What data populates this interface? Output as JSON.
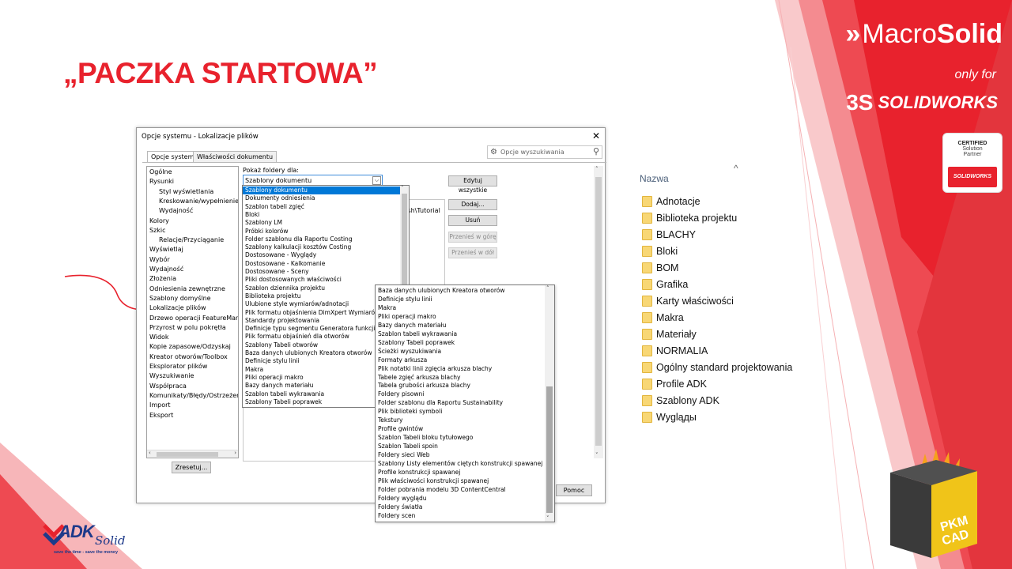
{
  "slide": {
    "title": "„PACZKA STARTOWA”",
    "brand": {
      "arrows": "»",
      "name_regular": "Macro",
      "name_bold": "Solid",
      "only_for": "only for",
      "solidworks_ds": "3S",
      "solidworks_text": "SOLIDWORKS"
    },
    "cert_badge": {
      "line1": "CERTIFIED",
      "line2": "Solution",
      "line3": "Partner",
      "strip": "SOLIDWORKS"
    },
    "adk_logo": {
      "big": "ADK",
      "script": "Solid",
      "tagline": "save the time - save the money"
    },
    "pkm_badge": "PKM CAD",
    "colors": {
      "accent_red": "#e8222d",
      "selection_blue": "#0078d7"
    }
  },
  "dialog": {
    "title": "Opcje systemu - Lokalizacje plików",
    "close_icon": "close-icon",
    "tabs": [
      "Opcje systemu",
      "Właściwości dokumentu"
    ],
    "search_placeholder": "Opcje wyszukiwania",
    "tree_items": [
      {
        "label": "Ogólne",
        "indent": 0
      },
      {
        "label": "Rysunki",
        "indent": 0
      },
      {
        "label": "Styl wyświetlania",
        "indent": 1
      },
      {
        "label": "Kreskowanie/wypełnienie o",
        "indent": 1
      },
      {
        "label": "Wydajność",
        "indent": 1
      },
      {
        "label": "Kolory",
        "indent": 0
      },
      {
        "label": "Szkic",
        "indent": 0
      },
      {
        "label": "Relacje/Przyciąganie",
        "indent": 1
      },
      {
        "label": "Wyświetlaj",
        "indent": 0
      },
      {
        "label": "Wybór",
        "indent": 0
      },
      {
        "label": "Wydajność",
        "indent": 0
      },
      {
        "label": "Złożenia",
        "indent": 0
      },
      {
        "label": "Odniesienia zewnętrzne",
        "indent": 0
      },
      {
        "label": "Szablony domyślne",
        "indent": 0
      },
      {
        "label": "Lokalizacje plików",
        "indent": 0
      },
      {
        "label": "Drzewo operacji FeatureManag",
        "indent": 0
      },
      {
        "label": "Przyrost w polu pokrętła",
        "indent": 0
      },
      {
        "label": "Widok",
        "indent": 0
      },
      {
        "label": "Kopie zapasowe/Odzyskaj",
        "indent": 0
      },
      {
        "label": "Kreator otworów/Toolbox",
        "indent": 0
      },
      {
        "label": "Eksplorator plików",
        "indent": 0
      },
      {
        "label": "Wyszukiwanie",
        "indent": 0
      },
      {
        "label": "Współpraca",
        "indent": 0
      },
      {
        "label": "Komunikaty/Błędy/Ostrzeżenia",
        "indent": 0
      },
      {
        "label": "Import",
        "indent": 0
      },
      {
        "label": "Eksport",
        "indent": 0
      }
    ],
    "reset_button": "Zresetuj...",
    "show_folders_label": "Pokaż foldery dla:",
    "combo_value": "Szablony dokumentu",
    "edit_all_button": "Edytuj wszystkie",
    "add_button": "Dodaj...",
    "delete_button": "Usuń",
    "move_up_button": "Przenieś w górę",
    "move_down_button": "Przenieś w dół",
    "path_fragment": "lish\\Tutorial",
    "help_button": "Pomoc"
  },
  "dropdown1": {
    "selected_index": 0,
    "items": [
      "Szablony dokumentu",
      "Dokumenty odniesienia",
      "Szablon tabeli zgięć",
      "Bloki",
      "Szablony LM",
      "Próbki kolorów",
      "Folder szablonu dla Raportu Costing",
      "Szablony kalkulacji kosztów Costing",
      "Dostosowane - Wyglądy",
      "Dostosowane - Kalkomanie",
      "Dostosowane - Sceny",
      "Pliki dostosowanych właściwości",
      "Szablon dziennika projektu",
      "Biblioteka projektu",
      "Ulubione style wymiarów/adnotacji",
      "Plik formatu objaśnienia DimXpert Wymiarów",
      "Standardy projektowania",
      "Definicje typu segmentu Generatora funkcji",
      "Plik formatu objaśnień dla otworów",
      "Szablony Tabeli otworów",
      "Baza danych ulubionych Kreatora otworów",
      "Definicje stylu linii",
      "Makra",
      "Pliki operacji makro",
      "Bazy danych materiału",
      "Szablon tabeli wykrawania",
      "Szablony Tabeli poprawek"
    ]
  },
  "dropdown2": {
    "items": [
      "Baza danych ulubionych Kreatora otworów",
      "Definicje stylu linii",
      "Makra",
      "Pliki operacji makro",
      "Bazy danych materiału",
      "Szablon tabeli wykrawania",
      "Szablony Tabeli poprawek",
      "Ścieżki wyszukiwania",
      "Formaty arkusza",
      "Plik notatki linii zgięcia arkusza blachy",
      "Tabele zgięć arkusza blachy",
      "Tabela grubości arkusza blachy",
      "Foldery pisowni",
      "Folder szablonu dla Raportu Sustainability",
      "Plik biblioteki symboli",
      "Tekstury",
      "Profile gwintów",
      "Szablon Tabeli bloku tytułowego",
      "Szablon Tabeli spoin",
      "Foldery sieci Web",
      "Szablony Listy elementów ciętych konstrukcji spawanej",
      "Profile konstrukcji spawanej",
      "Plik właściwości konstrukcji spawanej",
      "Folder pobrania modelu 3D ContentCentral",
      "Foldery wyglądu",
      "Foldery światła",
      "Foldery scen"
    ]
  },
  "folders": {
    "header": "Nazwa",
    "items": [
      "Adnotacje",
      "Biblioteka projektu",
      "BLACHY",
      "Bloki",
      "BOM",
      "Grafika",
      "Karty właściwości",
      "Makra",
      "Materiały",
      "NORMALIA",
      "Ogólny standard projektowania",
      "Profile ADK",
      "Szablony ADK",
      "Wygląды"
    ]
  }
}
